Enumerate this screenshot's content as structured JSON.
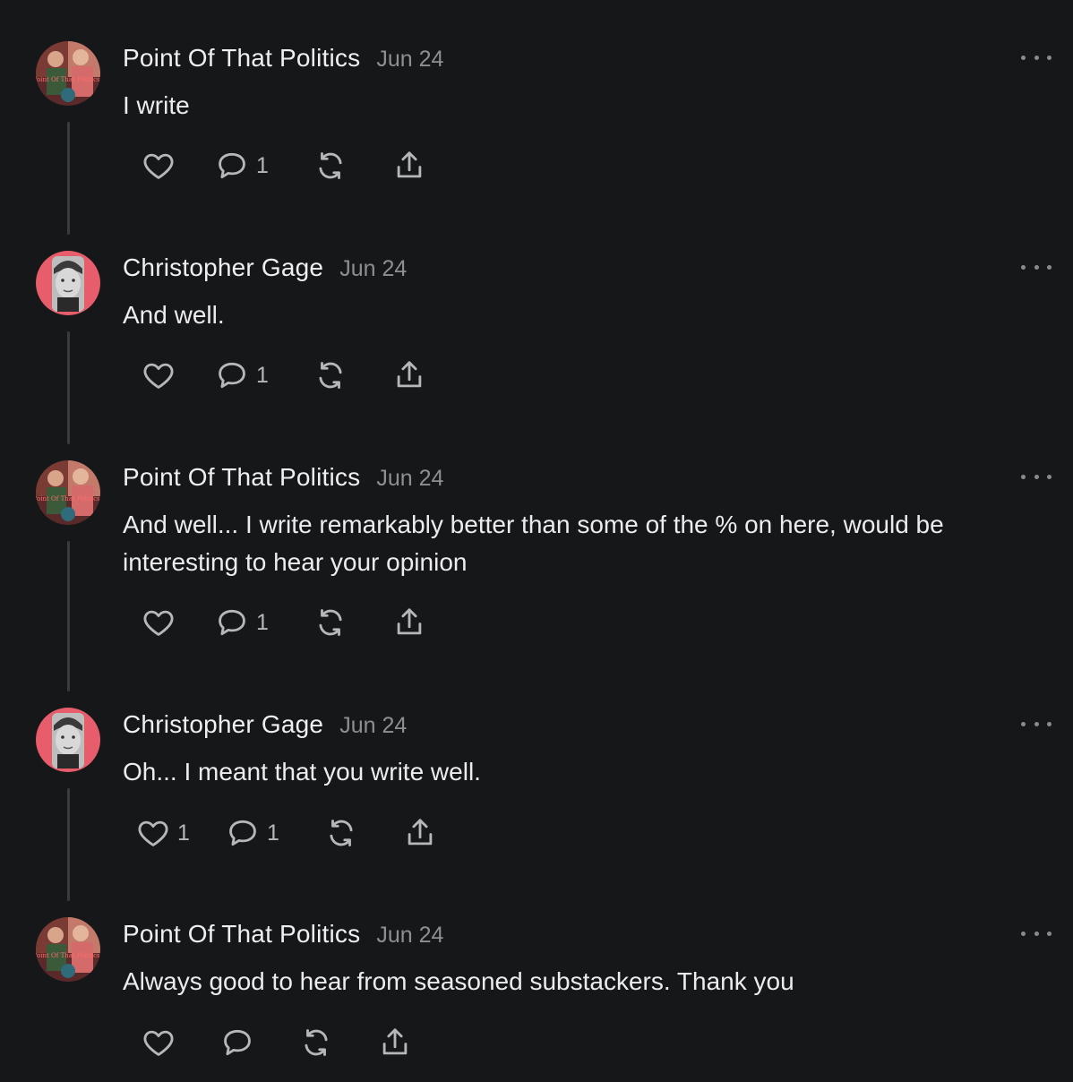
{
  "comments": [
    {
      "author": "Point Of That Politics",
      "date": "Jun 24",
      "avatar_text": "Point Of That Politics?",
      "body": "I write",
      "likes": "",
      "replies": "1"
    },
    {
      "author": "Christopher Gage",
      "date": "Jun 24",
      "body": "And well.",
      "likes": "",
      "replies": "1"
    },
    {
      "author": "Point Of That Politics",
      "date": "Jun 24",
      "avatar_text": "Point Of That Politics?",
      "body": "And well... I write remarkably better than some of the % on here, would be interesting to hear your opinion",
      "likes": "",
      "replies": "1"
    },
    {
      "author": "Christopher Gage",
      "date": "Jun 24",
      "body": "Oh... I meant that you write well.",
      "likes": "1",
      "replies": "1"
    },
    {
      "author": "Point Of That Politics",
      "date": "Jun 24",
      "avatar_text": "Point Of That Politics?",
      "body": "Always good to hear from seasoned substackers. Thank you",
      "likes": "",
      "replies": ""
    }
  ],
  "icons": {
    "like": "heart-icon",
    "reply": "comment-bubble-icon",
    "restack": "restack-icon",
    "share": "share-icon",
    "more": "more-options-icon"
  },
  "colors": {
    "background": "#161719",
    "text": "#ececee",
    "muted": "#8e8f93",
    "icon": "#b6b7bb",
    "thread_line": "#3a3b3e"
  }
}
